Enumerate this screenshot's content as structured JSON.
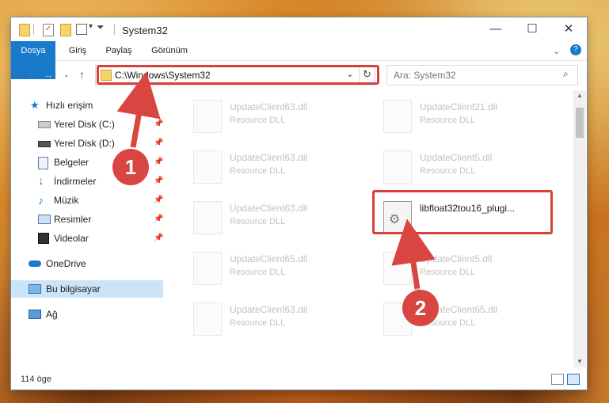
{
  "window": {
    "title": "System32",
    "controls": {
      "minimize": "—",
      "maximize": "☐",
      "close": "✕"
    }
  },
  "ribbon": {
    "tabs": [
      {
        "label": "Dosya"
      },
      {
        "label": "Giriş"
      },
      {
        "label": "Paylaş"
      },
      {
        "label": "Görünüm"
      }
    ]
  },
  "address": {
    "path": "C:\\Windows\\System32",
    "search_placeholder": "Ara: System32"
  },
  "sidebar": {
    "items": [
      {
        "label": "Hızlı erişim",
        "icon": "star-icon"
      },
      {
        "label": "Yerel Disk (C:)",
        "icon": "drive-icon",
        "pinned": true
      },
      {
        "label": "Yerel Disk (D:)",
        "icon": "drive-icon",
        "pinned": true
      },
      {
        "label": "Belgeler",
        "icon": "documents-icon",
        "pinned": true
      },
      {
        "label": "İndirmeler",
        "icon": "download-icon",
        "pinned": true
      },
      {
        "label": "Müzik",
        "icon": "music-icon",
        "pinned": true
      },
      {
        "label": "Resimler",
        "icon": "pictures-icon",
        "pinned": true
      },
      {
        "label": "Videolar",
        "icon": "videos-icon",
        "pinned": true
      },
      {
        "label": "OneDrive",
        "icon": "cloud-icon"
      },
      {
        "label": "Bu bilgisayar",
        "icon": "computer-icon",
        "selected": true
      },
      {
        "label": "Ağ",
        "icon": "network-icon"
      }
    ]
  },
  "files": {
    "left": [
      {
        "name": "UpdateClient63.dll",
        "type": "Resource DLL"
      },
      {
        "name": "UpdateClient63.dll",
        "type": "Resource DLL"
      },
      {
        "name": "UpdateClient63.dll",
        "type": "Resource DLL"
      },
      {
        "name": "UpdateClient65.dll",
        "type": "Resource DLL"
      },
      {
        "name": "UpdateClient63.dll",
        "type": "Resource DLL"
      }
    ],
    "right": [
      {
        "name": "UpdateClient21.dll",
        "type": "Resource DLL"
      },
      {
        "name": "UpdateClient5.dll",
        "type": "Resource DLL"
      },
      {
        "name": "libfloat32tou16_plugi...",
        "type": ""
      },
      {
        "name": "UpdateClient5.dll",
        "type": "Resource DLL"
      },
      {
        "name": "UpdateClient65.dll",
        "type": "Resource DLL"
      }
    ]
  },
  "status": {
    "count": "114 öge"
  },
  "annotations": {
    "step1": "1",
    "step2": "2"
  },
  "colors": {
    "accent": "#1979ca",
    "highlight": "#d9403a",
    "selected_bg": "#cce4f7"
  }
}
